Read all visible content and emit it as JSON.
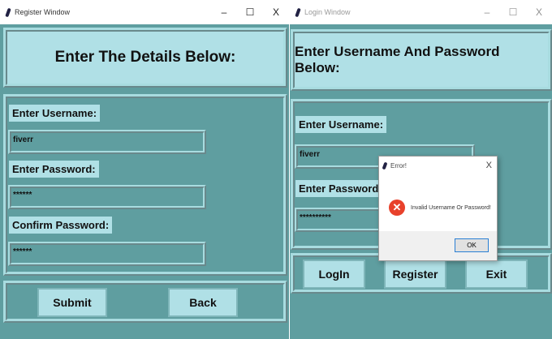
{
  "register": {
    "title": "Register Window",
    "heading": "Enter The Details Below:",
    "username_label": "Enter Username:",
    "username_value": "fiverr",
    "password_label": "Enter Password:",
    "password_value": "******",
    "confirm_label": "Confirm Password:",
    "confirm_value": "******",
    "submit": "Submit",
    "back": "Back"
  },
  "login": {
    "title": "Login Window",
    "heading": "Enter Username And Password Below:",
    "username_label": "Enter Username:",
    "username_value": "fiverr",
    "password_label": "Enter Password:",
    "password_value": "**********",
    "login": "LogIn",
    "register": "Register",
    "exit": "Exit"
  },
  "dialog": {
    "title": "Error!",
    "message": "Invalid Username Or Password!",
    "ok": "OK"
  },
  "controls": {
    "minimize": "–",
    "maximize": "☐",
    "close": "X"
  },
  "colors": {
    "light": "#b0e0e6",
    "dark": "#5f9ea0"
  }
}
